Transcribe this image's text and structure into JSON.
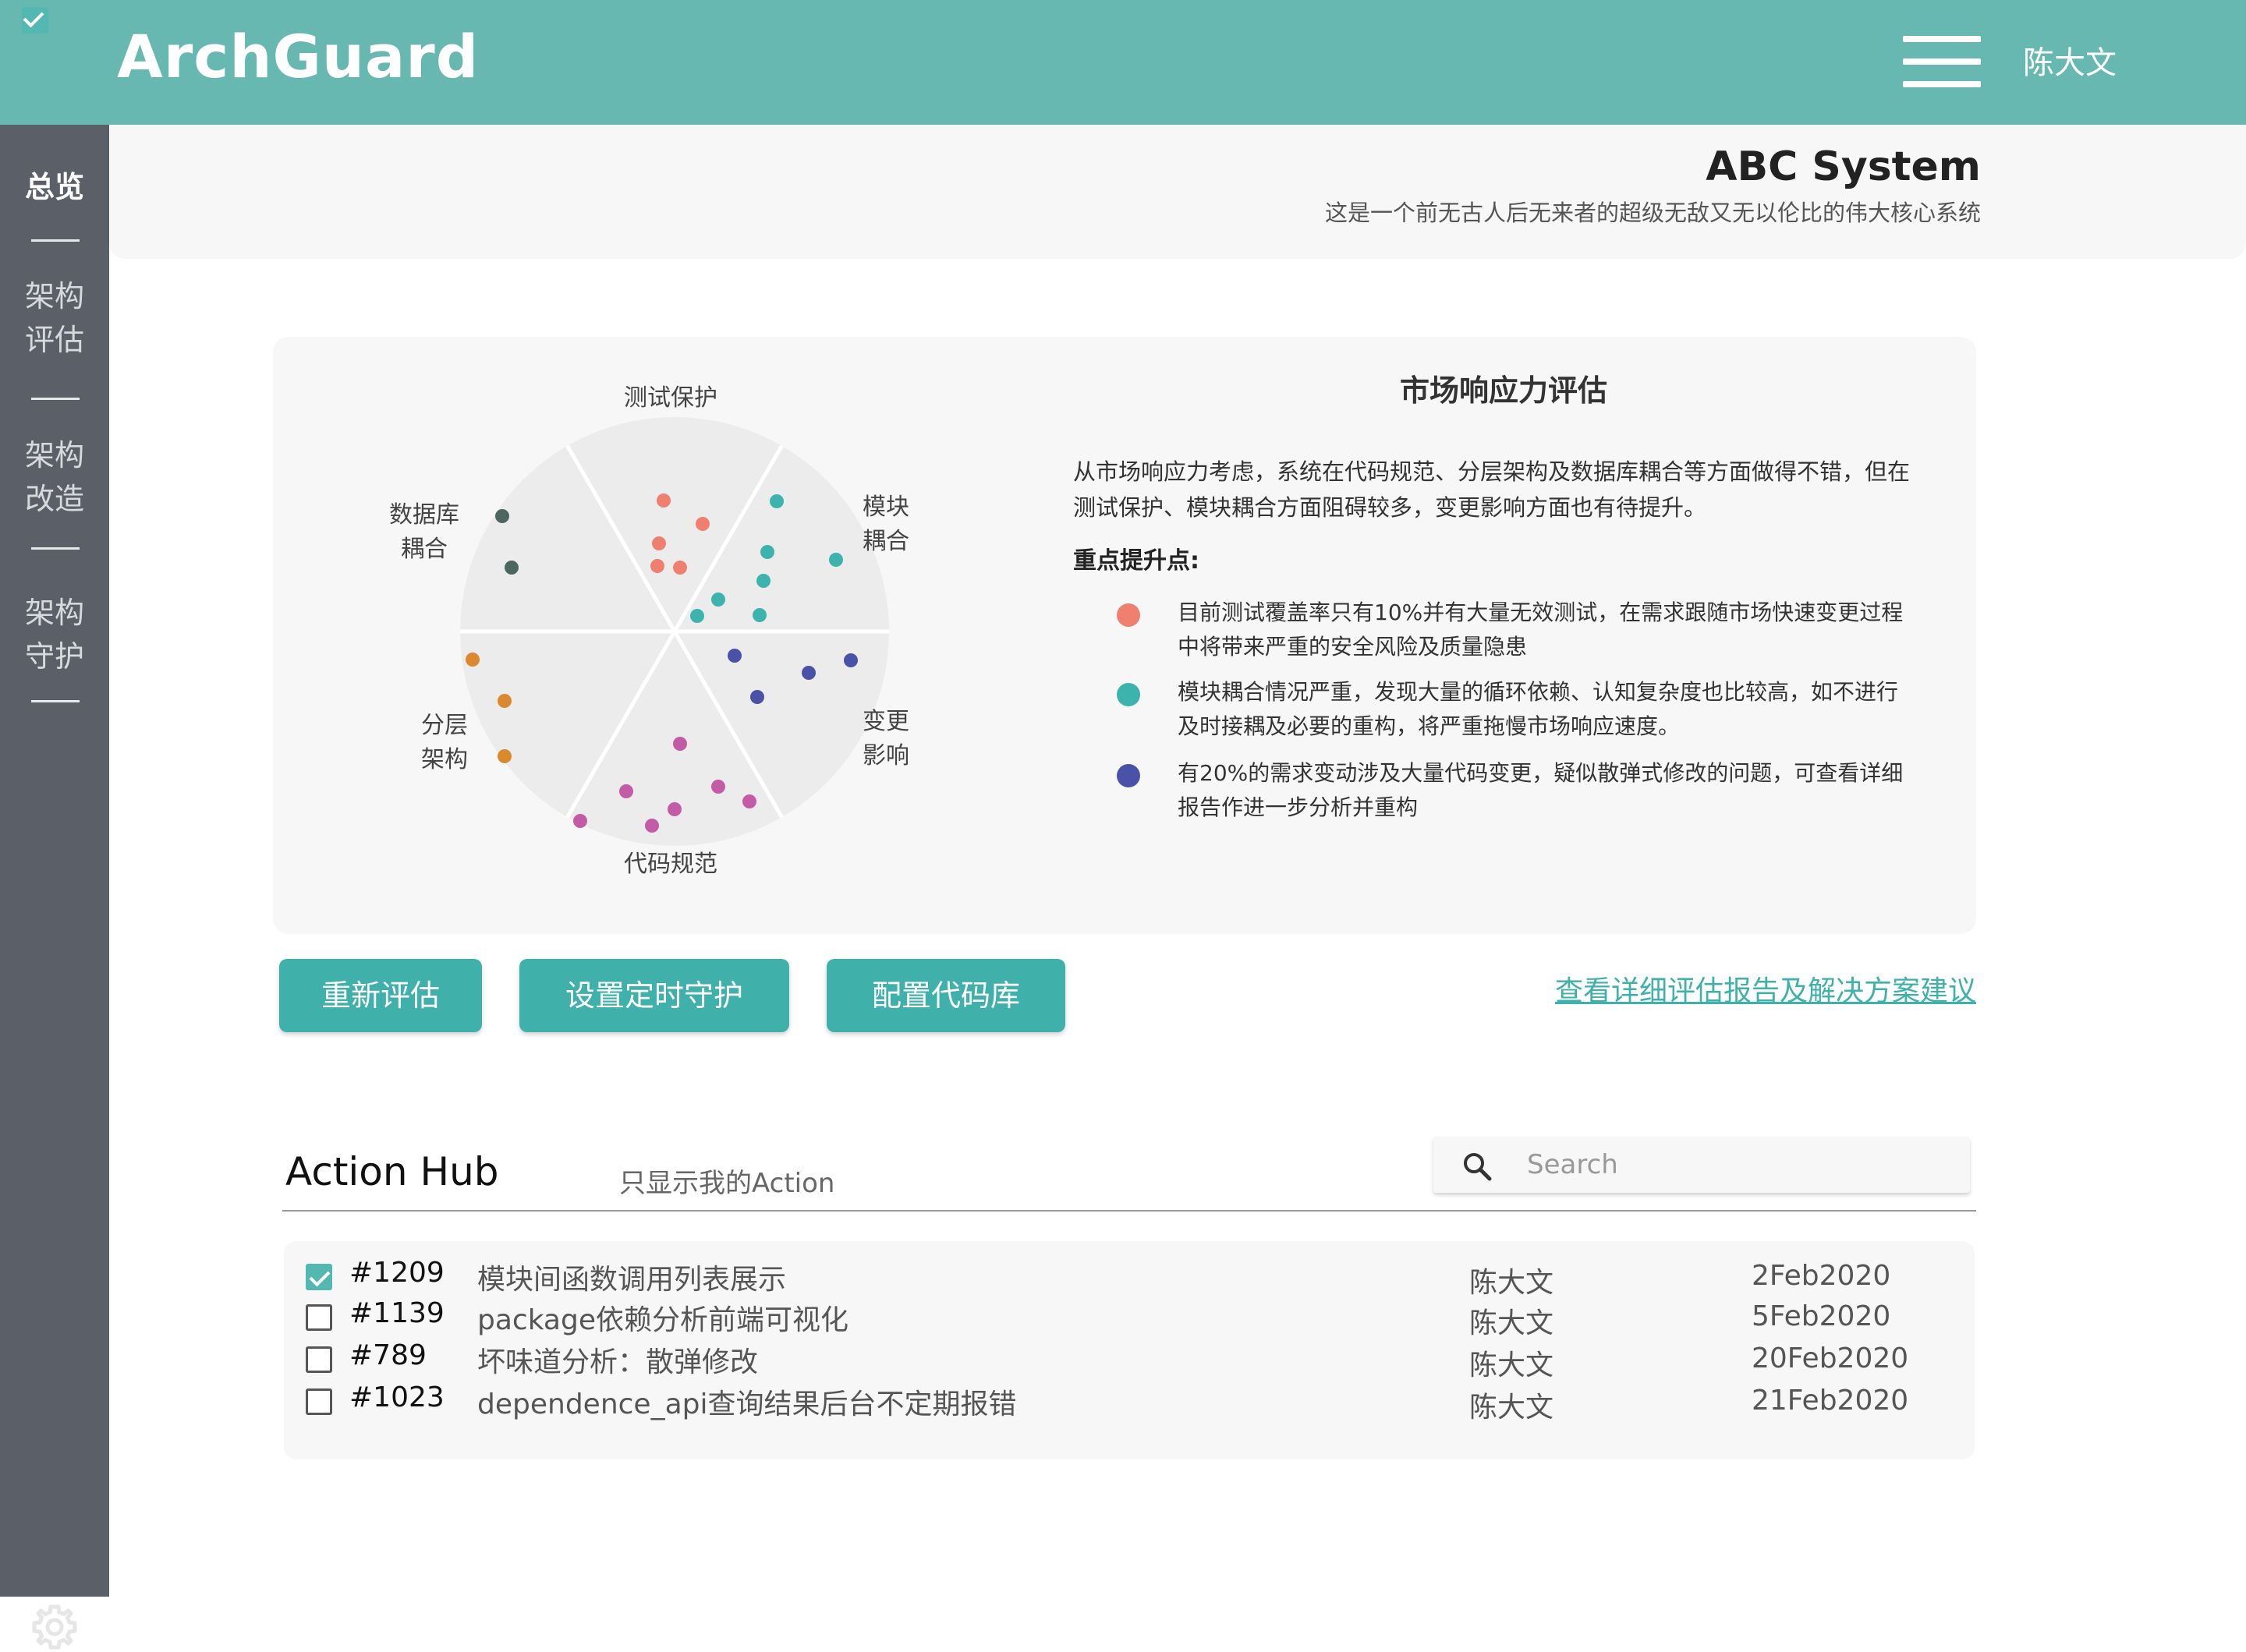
{
  "header": {
    "logo": "ArchGuard",
    "user": "陈大文"
  },
  "sidebar": {
    "items": [
      {
        "label": "总览",
        "active": true
      },
      {
        "label": "架构评估",
        "line1": "架构",
        "line2": "评估"
      },
      {
        "label": "架构改造",
        "line1": "架构",
        "line2": "改造"
      },
      {
        "label": "架构守护",
        "line1": "架构",
        "line2": "守护"
      }
    ],
    "settings_icon": "gear-icon"
  },
  "system": {
    "name": "ABC System",
    "description": "这是一个前无古人后无来者的超级无敌又无以伦比的伟大核心系统"
  },
  "assessment": {
    "title": "市场响应力评估",
    "summary": "从市场响应力考虑，系统在代码规范、分层架构及数据库耦合等方面做得不错，但在测试保护、模块耦合方面阻碍较多，变更影响方面也有待提升。",
    "focus_title": "重点提升点:",
    "points": [
      {
        "text": "目前测试覆盖率只有10%并有大量无效测试，在需求跟随市场快速变更过程中将带来严重的安全风险及质量隐患",
        "color": "#ef8070"
      },
      {
        "text": "模块耦合情况严重，发现大量的循环依赖、认知复杂度也比较高，如不进行及时接耦及必要的重构，将严重拖慢市场响应速度。",
        "color": "#3cb3ad"
      },
      {
        "text": "有20%的需求变动涉及大量代码变更，疑似散弹式修改的问题，可查看详细报告作进一步分析并重构",
        "color": "#4a52a8"
      }
    ],
    "radar": {
      "axes": [
        {
          "label": "测试保护"
        },
        {
          "label": "模块",
          "label2": "耦合"
        },
        {
          "label": "变更",
          "label2": "影响"
        },
        {
          "label": "代码规范"
        },
        {
          "label": "分层",
          "label2": "架构"
        },
        {
          "label": "数据库",
          "label2": "耦合"
        }
      ],
      "colors": {
        "test": "#ef8070",
        "module": "#3cb3ad",
        "change": "#4a52a8",
        "code": "#c45ba6",
        "layer": "#d98a2e",
        "db": "#4d6660"
      }
    }
  },
  "actions": {
    "reassess": "重新评估",
    "schedule": "设置定时守护",
    "repo": "配置代码库",
    "report_link": "查看详细评估报告及解决方案建议"
  },
  "hub": {
    "title": "Action Hub",
    "filter_label": "只显示我的Action",
    "filter_checked": true,
    "search_placeholder": "Search",
    "rows": [
      {
        "id": "#1209",
        "title": "模块间函数调用列表展示",
        "owner": "陈大文",
        "date": "2Feb2020",
        "checked": true
      },
      {
        "id": "#1139",
        "title": "package依赖分析前端可视化",
        "owner": "陈大文",
        "date": "5Feb2020",
        "checked": false
      },
      {
        "id": "#789",
        "title": "坏味道分析：散弹修改",
        "owner": "陈大文",
        "date": "20Feb2020",
        "checked": false
      },
      {
        "id": "#1023",
        "title": "dependence_api查询结果后台不定期报错",
        "owner": "陈大文",
        "date": "21Feb2020",
        "checked": false
      }
    ]
  }
}
